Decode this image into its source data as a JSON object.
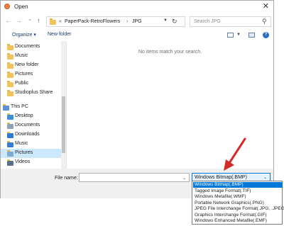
{
  "window": {
    "title": "Open",
    "close_glyph": "✕"
  },
  "nav": {
    "back_glyph": "←",
    "forward_glyph": "→",
    "recent_glyph": "⌄",
    "up_glyph": "↑",
    "breadcrumb_prefix": "«",
    "breadcrumb": [
      "PaperPack-RetroFlowers",
      "JPG"
    ],
    "breadcrumb_sep": "›",
    "refresh_glyph": "↻",
    "search_placeholder": "Search JPG",
    "search_glyph": "⚲"
  },
  "toolbar": {
    "organize": "Organize ▾",
    "new_folder": "New folder",
    "help": "?"
  },
  "sidebar": {
    "items": [
      {
        "label": "Documents",
        "icon": "folder-icon",
        "selected": false
      },
      {
        "label": "Music",
        "icon": "folder-icon",
        "selected": false
      },
      {
        "label": "New folder",
        "icon": "folder-icon",
        "selected": false
      },
      {
        "label": "Pictures",
        "icon": "folder-icon",
        "selected": false
      },
      {
        "label": "Public",
        "icon": "folder-icon",
        "selected": false
      },
      {
        "label": "Studioplus Share",
        "icon": "folder-icon",
        "selected": false
      },
      {
        "label": "This PC",
        "icon": "computer-icon",
        "selected": false
      },
      {
        "label": "Desktop",
        "icon": "desktop-icon",
        "selected": false
      },
      {
        "label": "Documents",
        "icon": "documents-icon",
        "selected": false
      },
      {
        "label": "Downloads",
        "icon": "downloads-icon",
        "selected": false
      },
      {
        "label": "Music",
        "icon": "music-icon",
        "selected": false
      },
      {
        "label": "Pictures",
        "icon": "pictures-icon",
        "selected": true
      },
      {
        "label": "Videos",
        "icon": "videos-icon",
        "selected": false
      }
    ]
  },
  "main": {
    "empty_message": "No items match your search."
  },
  "bottom": {
    "file_name_label": "File name:",
    "file_name_value": "",
    "file_type_selected": "Windows Bitmap(.BMP)"
  },
  "file_type_options": [
    "Windows Bitmap(.BMP)",
    "Tagged Image Format(.TIF)",
    "Windows Metafile(.WMF)",
    "Portable Network Graphics(.PNG)",
    "JPEG File Interchange Format(.JPG, .JPEG)",
    "Graphics Interchange Format(.GIF)",
    "Windows Enhanced Metafile(.EMF)"
  ],
  "colors": {
    "accent": "#0078d7",
    "annotation_arrow": "#d42a2a",
    "selection": "#cce8ff"
  }
}
